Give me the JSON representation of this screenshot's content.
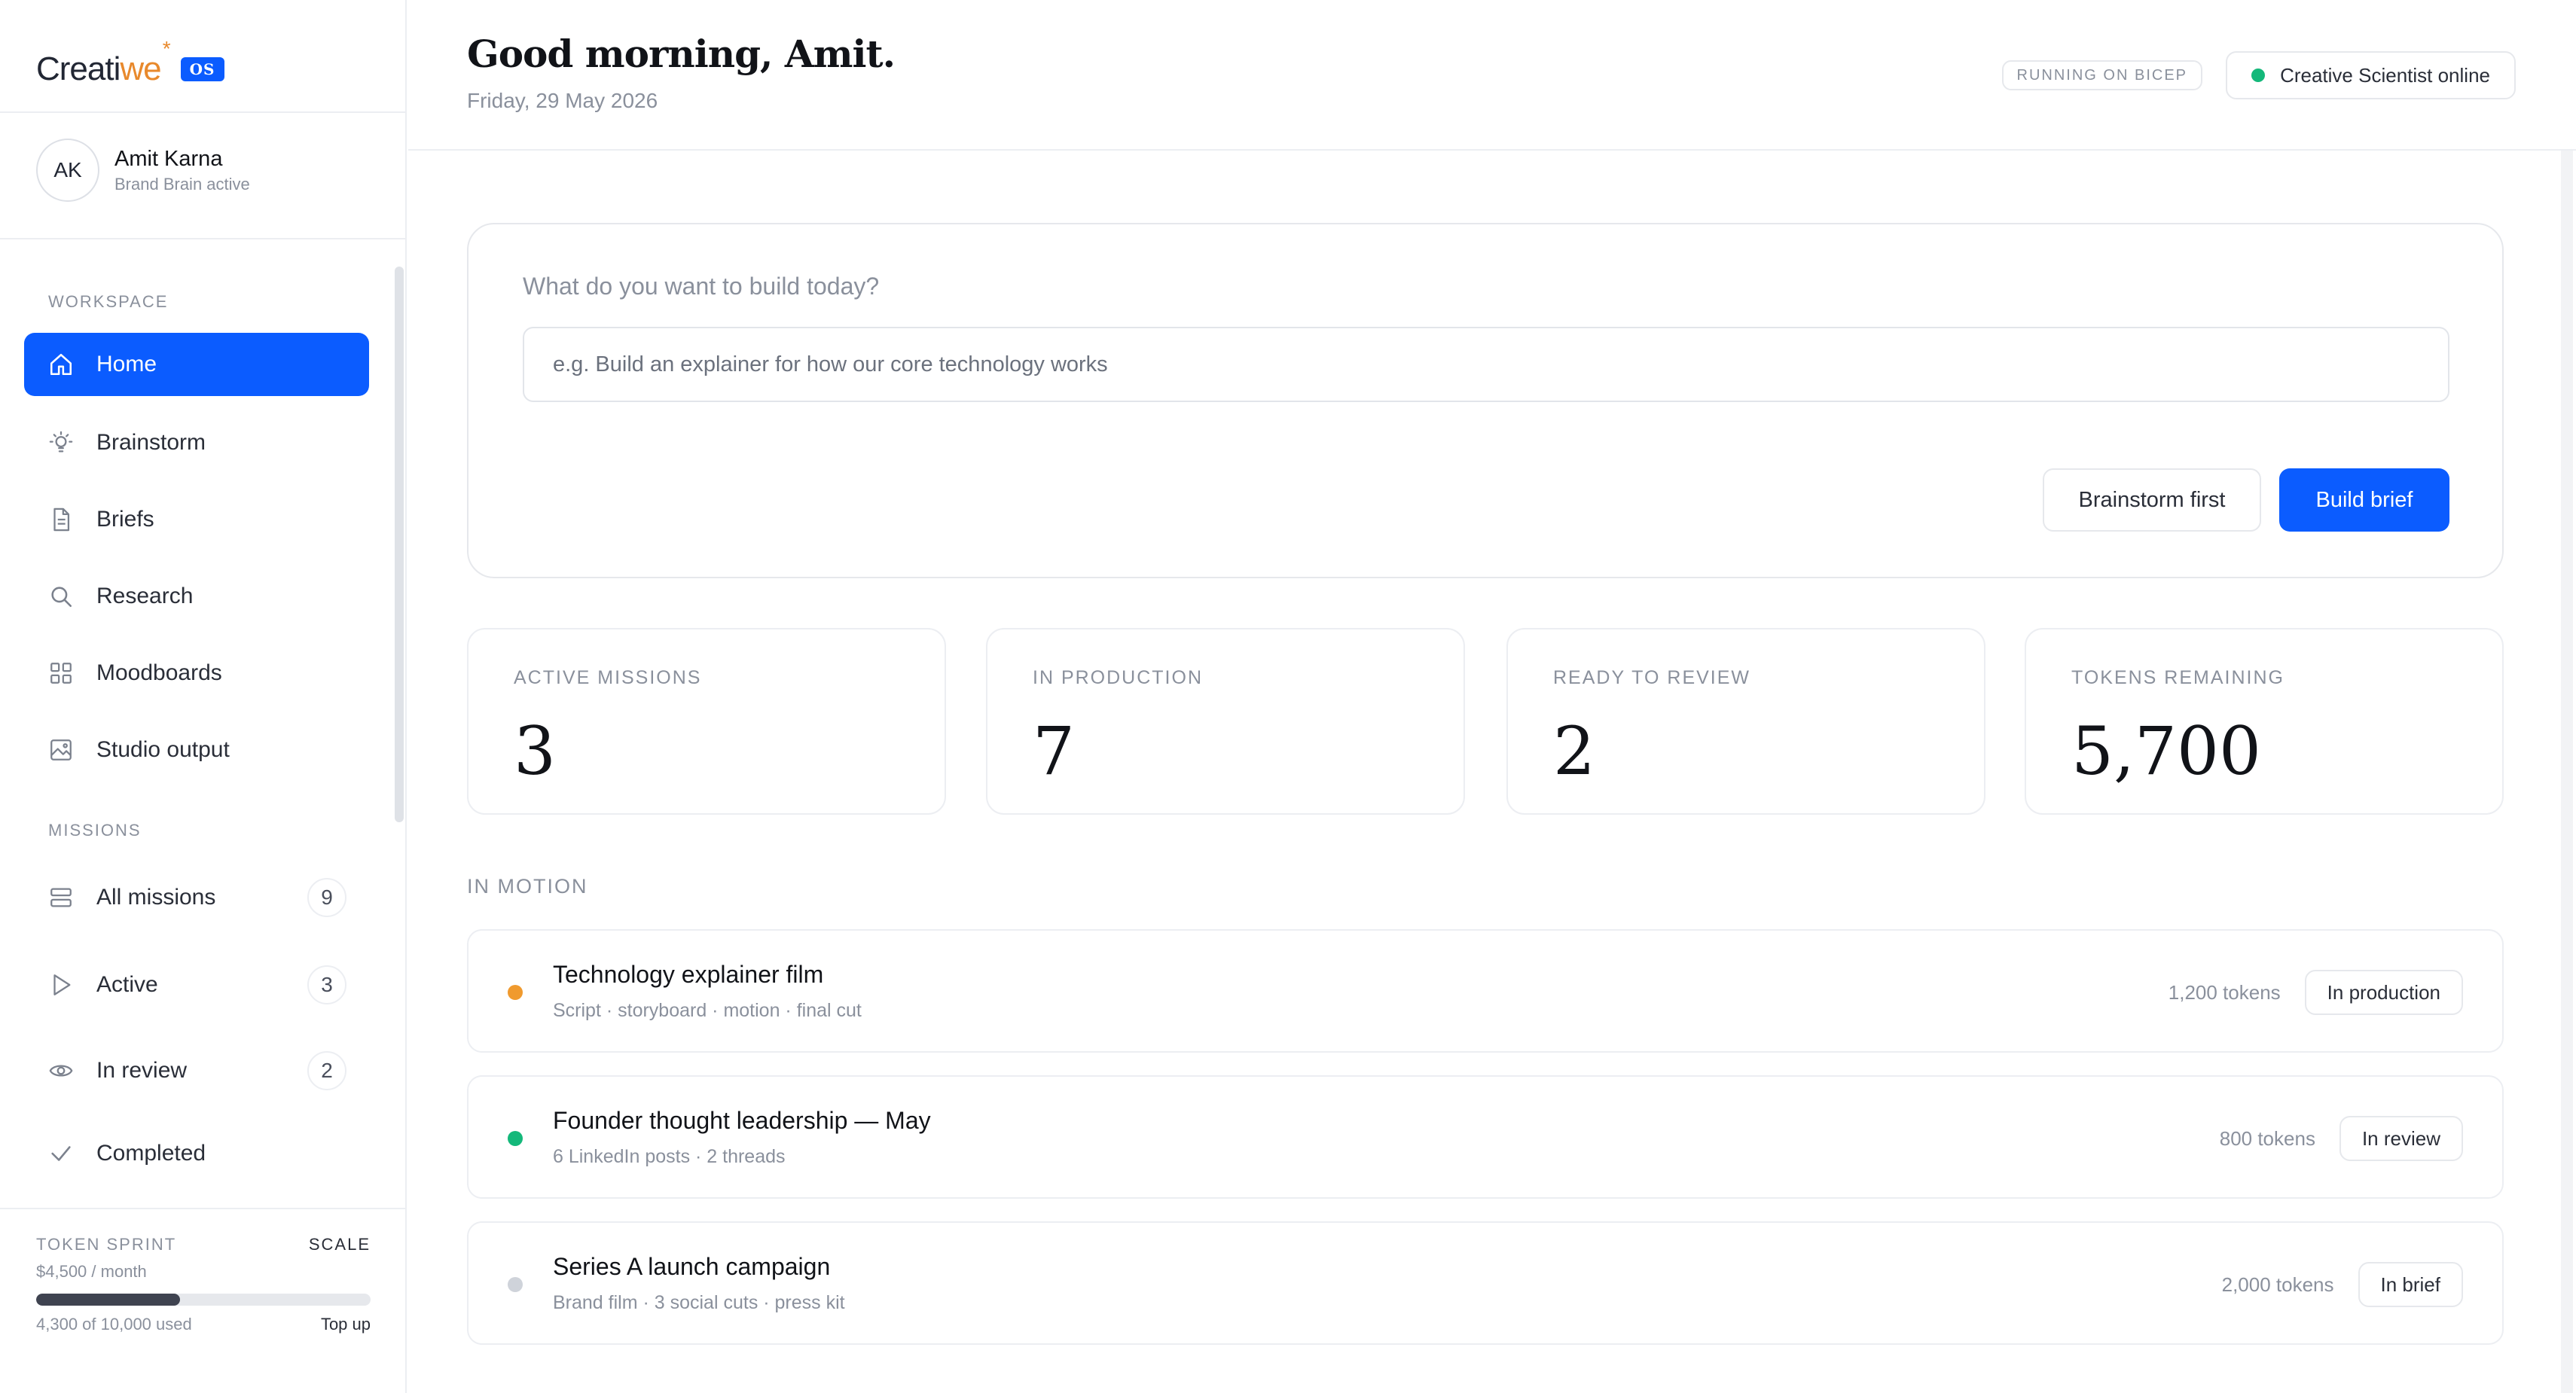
{
  "brand": {
    "logo_main": "Creati",
    "logo_accent": "we",
    "logo_badge": "OS",
    "accent_color": "#0b5cff",
    "logo_color": "#e8892c"
  },
  "user": {
    "initials": "AK",
    "name": "Amit Karna",
    "status": "Brand Brain active"
  },
  "sidebar": {
    "workspace_label": "WORKSPACE",
    "workspace_items": [
      {
        "label": "Home",
        "icon": "home-icon",
        "active": true
      },
      {
        "label": "Brainstorm",
        "icon": "lightbulb-icon"
      },
      {
        "label": "Briefs",
        "icon": "document-icon"
      },
      {
        "label": "Research",
        "icon": "search-icon"
      },
      {
        "label": "Moodboards",
        "icon": "grid-icon"
      },
      {
        "label": "Studio output",
        "icon": "image-icon"
      }
    ],
    "missions_label": "MISSIONS",
    "mission_items": [
      {
        "label": "All missions",
        "icon": "stack-icon",
        "count": "9"
      },
      {
        "label": "Active",
        "icon": "play-icon",
        "count": "3"
      },
      {
        "label": "In review",
        "icon": "eye-icon",
        "count": "2"
      },
      {
        "label": "Completed",
        "icon": "check-icon"
      }
    ]
  },
  "sprint": {
    "label": "TOKEN SPRINT",
    "plan": "SCALE",
    "price": "$4,500 / month",
    "used_text": "4,300 of 10,000 used",
    "used_fraction": 0.43,
    "topup_label": "Top up"
  },
  "header": {
    "greeting": "Good morning, Amit.",
    "date": "Friday, 29 May 2026",
    "running_label": "RUNNING ON BICEP",
    "online_label": "Creative Scientist online",
    "online_color": "#14b87a"
  },
  "prompt": {
    "question": "What do you want to build today?",
    "placeholder": "e.g. Build an explainer for how our core technology works",
    "secondary_button": "Brainstorm first",
    "primary_button": "Build brief"
  },
  "stats": [
    {
      "label": "ACTIVE MISSIONS",
      "value": "3"
    },
    {
      "label": "IN PRODUCTION",
      "value": "7"
    },
    {
      "label": "READY TO REVIEW",
      "value": "2"
    },
    {
      "label": "TOKENS REMAINING",
      "value": "5,700"
    }
  ],
  "in_motion": {
    "label": "IN MOTION",
    "missions": [
      {
        "title": "Technology explainer film",
        "subtitle": "Script · storyboard · motion · final cut",
        "tokens": "1,200 tokens",
        "status": "In production",
        "dot_color": "#f09a2e"
      },
      {
        "title": "Founder thought leadership — May",
        "subtitle": "6 LinkedIn posts · 2 threads",
        "tokens": "800 tokens",
        "status": "In review",
        "dot_color": "#14b87a"
      },
      {
        "title": "Series A launch campaign",
        "subtitle": "Brand film · 3 social cuts · press kit",
        "tokens": "2,000 tokens",
        "status": "In brief",
        "dot_color": "#cfd3da"
      }
    ]
  }
}
